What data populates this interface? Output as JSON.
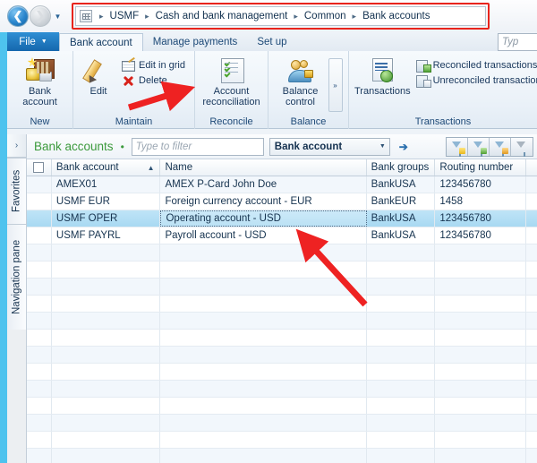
{
  "window": {
    "nav": {
      "back_label": "Back",
      "forward_label": "Forward",
      "history_label": "Recent pages"
    },
    "address": {
      "icon": "grid-icon",
      "breadcrumb": [
        "USMF",
        "Cash and bank management",
        "Common",
        "Bank accounts"
      ],
      "separator": "▸"
    },
    "search": {
      "value": "",
      "placeholder": "Typ"
    }
  },
  "ribbon": {
    "file_tab": {
      "label": "File",
      "caret": "▼"
    },
    "tabs": [
      {
        "label": "Bank account",
        "active": true
      },
      {
        "label": "Manage payments",
        "active": false
      },
      {
        "label": "Set up",
        "active": false
      }
    ],
    "groups": [
      {
        "label": "New",
        "big_buttons": [
          {
            "label": "Bank\naccount",
            "icon": "bank-account-icon"
          }
        ],
        "small_buttons": []
      },
      {
        "label": "Maintain",
        "big_buttons": [
          {
            "label": "Edit",
            "icon": "pencil-icon"
          }
        ],
        "small_buttons": [
          {
            "label": "Edit in grid",
            "icon": "grid-edit-icon"
          },
          {
            "label": "Delete",
            "icon": "delete-x-icon"
          }
        ]
      },
      {
        "label": "Reconcile",
        "big_buttons": [
          {
            "label": "Account\nreconciliation",
            "icon": "account-reconciliation-icon"
          }
        ],
        "small_buttons": []
      },
      {
        "label": "Balance",
        "big_buttons": [
          {
            "label": "Balance\ncontrol",
            "icon": "balance-control-icon"
          }
        ],
        "small_buttons": [],
        "overflow": "»"
      },
      {
        "label": "Transactions",
        "big_buttons": [
          {
            "label": "Transactions",
            "icon": "transactions-icon"
          }
        ],
        "small_buttons": [
          {
            "label": "Reconciled transactions",
            "icon": "reconciled-transactions-icon"
          },
          {
            "label": "Unreconciled transactions",
            "icon": "unreconciled-transactions-icon"
          }
        ]
      }
    ]
  },
  "side_tabs": {
    "expand": "›",
    "items": [
      {
        "label": "Favorites"
      },
      {
        "label": "Navigation pane"
      }
    ]
  },
  "list_page": {
    "title": "Bank accounts",
    "title_dot": "•",
    "filter": {
      "value": "",
      "placeholder": "Type to filter",
      "field_selected": "Bank account",
      "caret": "▼",
      "go": "➔"
    },
    "filter_tools": [
      {
        "name": "advanced-filter-sort-button"
      },
      {
        "name": "filter-by-grid-button"
      },
      {
        "name": "filter-by-selection-button"
      },
      {
        "name": "clear-filter-button"
      }
    ]
  },
  "grid": {
    "columns": [
      {
        "label": "",
        "key": "select"
      },
      {
        "label": "Bank account",
        "key": "bank_account",
        "sorted": "asc",
        "sort_caret": "▲"
      },
      {
        "label": "Name",
        "key": "name"
      },
      {
        "label": "Bank groups",
        "key": "bank_groups"
      },
      {
        "label": "Routing number",
        "key": "routing_number"
      }
    ],
    "rows": [
      {
        "bank_account": "AMEX01",
        "name": "AMEX P-Card John Doe",
        "bank_groups": "BankUSA",
        "routing_number": "123456780",
        "selected": false
      },
      {
        "bank_account": "USMF EUR",
        "name": "Foreign currency account - EUR",
        "bank_groups": "BankEUR",
        "routing_number": "1458",
        "selected": false
      },
      {
        "bank_account": "USMF OPER",
        "name": "Operating account - USD",
        "bank_groups": "BankUSA",
        "routing_number": "123456780",
        "selected": true
      },
      {
        "bank_account": "USMF PAYRL",
        "name": "Payroll account - USD",
        "bank_groups": "BankUSA",
        "routing_number": "123456780",
        "selected": false
      }
    ],
    "empty_row_count": 13
  },
  "annotations": {
    "highlight_box_color": "#e8241c",
    "arrow_color": "#ee2222",
    "arrows": [
      {
        "name": "arrow-to-account-reconciliation",
        "target": "Account reconciliation"
      },
      {
        "name": "arrow-to-selected-row",
        "target": "Operating account - USD"
      }
    ]
  }
}
